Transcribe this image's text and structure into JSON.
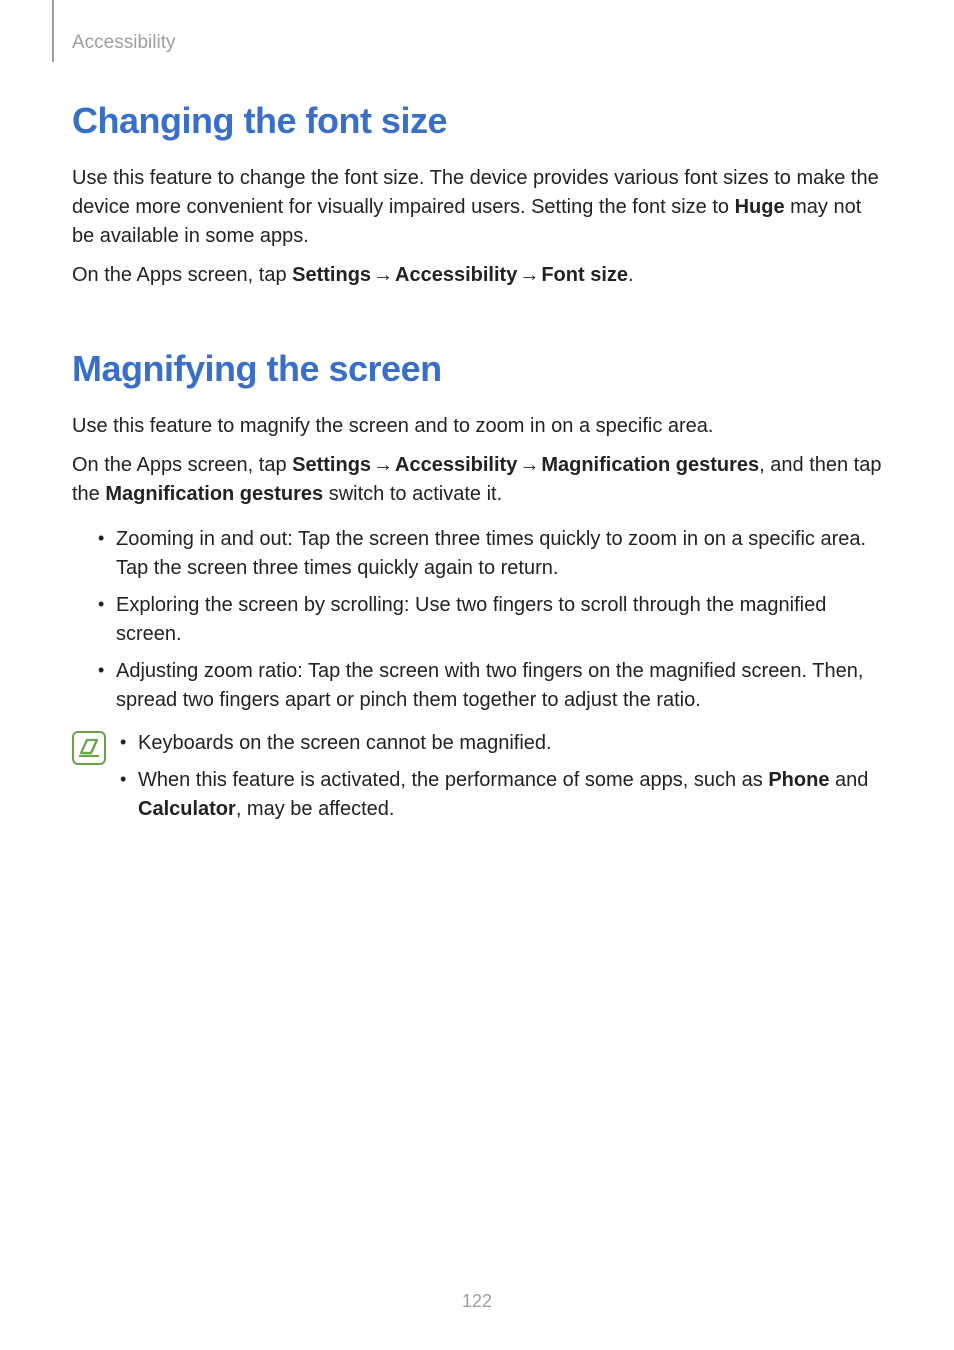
{
  "header": {
    "section_label": "Accessibility"
  },
  "arrow": "→",
  "section1": {
    "title": "Changing the font size",
    "p1_a": "Use this feature to change the font size. The device provides various font sizes to make the device more convenient for visually impaired users. Setting the font size to ",
    "p1_bold": "Huge",
    "p1_b": " may not be available in some apps.",
    "p2_a": "On the Apps screen, tap ",
    "p2_nav1": "Settings",
    "p2_nav2": "Accessibility",
    "p2_nav3": "Font size",
    "p2_end": "."
  },
  "section2": {
    "title": "Magnifying the screen",
    "p1": "Use this feature to magnify the screen and to zoom in on a specific area.",
    "p2_a": "On the Apps screen, tap ",
    "p2_nav1": "Settings",
    "p2_nav2": "Accessibility",
    "p2_nav3": "Magnification gestures",
    "p2_b": ", and then tap the ",
    "p2_bold2": "Magnification gestures",
    "p2_c": " switch to activate it.",
    "bullets": [
      "Zooming in and out: Tap the screen three times quickly to zoom in on a specific area. Tap the screen three times quickly again to return.",
      "Exploring the screen by scrolling: Use two fingers to scroll through the magnified screen.",
      "Adjusting zoom ratio: Tap the screen with two fingers on the magnified screen. Then, spread two fingers apart or pinch them together to adjust the ratio."
    ],
    "note": {
      "n1": "Keyboards on the screen cannot be magnified.",
      "n2_a": "When this feature is activated, the performance of some apps, such as ",
      "n2_b1": "Phone",
      "n2_mid": " and ",
      "n2_b2": "Calculator",
      "n2_end": ", may be affected."
    }
  },
  "page_number": "122"
}
